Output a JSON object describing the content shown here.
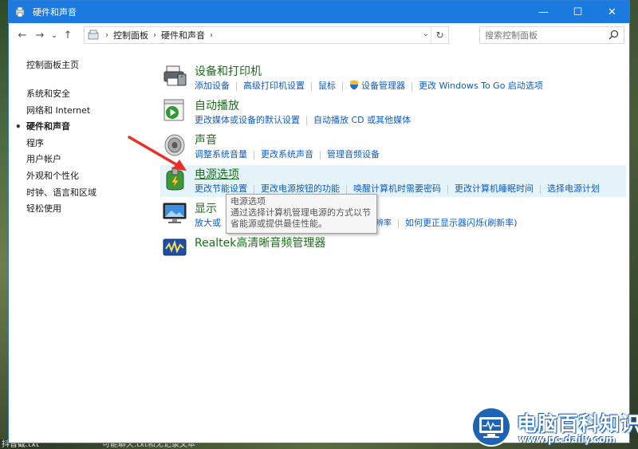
{
  "window": {
    "title": "硬件和声音",
    "controls": {
      "minimize": "—",
      "maximize": "☐",
      "close": "✕"
    }
  },
  "nav": {
    "back": "←",
    "forward": "→",
    "recent": "⌄",
    "up": "↑"
  },
  "address": {
    "crumbs": [
      "控制面板",
      "硬件和声音"
    ],
    "sep": "›",
    "dropdown": "⌄",
    "refresh": "↻"
  },
  "search": {
    "placeholder": "搜索控制面板"
  },
  "sidebar": {
    "home": "控制面板主页",
    "items": [
      {
        "label": "系统和安全"
      },
      {
        "label": "网络和 Internet"
      },
      {
        "label": "硬件和声音",
        "current": true
      },
      {
        "label": "程序"
      },
      {
        "label": "用户帐户"
      },
      {
        "label": "外观和个性化"
      },
      {
        "label": "时钟、语言和区域"
      },
      {
        "label": "轻松使用"
      }
    ],
    "bullet": "•"
  },
  "categories": [
    {
      "title": "设备和打印机",
      "icon": "printer-icon",
      "links": [
        "添加设备",
        "高级打印机设置",
        "鼠标",
        "设备管理器",
        "更改 Windows To Go 启动选项"
      ]
    },
    {
      "title": "自动播放",
      "icon": "autoplay-icon",
      "links": [
        "更改媒体或设备的默认设置",
        "自动播放 CD 或其他媒体"
      ]
    },
    {
      "title": "声音",
      "icon": "speaker-icon",
      "links": [
        "调整系统音量",
        "更改系统声音",
        "管理音频设备"
      ]
    },
    {
      "title": "电源选项",
      "icon": "power-icon",
      "links": [
        "更改节能设置",
        "更改电源按钮的功能",
        "唤醒计算机时需要密码",
        "更改计算机睡眠时间",
        "选择电源计划"
      ]
    },
    {
      "title": "显示",
      "icon": "monitor-icon",
      "links": [
        "放大或",
        "调整屏幕分辨率",
        "如何更正显示器闪烁(刷新率)"
      ]
    },
    {
      "title": "Realtek高清晰音频管理器",
      "icon": "realtek-icon",
      "links": []
    }
  ],
  "tooltip": {
    "title": "电源选项",
    "body": "通过选择计算机管理电源的方式以节省能源或提供最佳性能。"
  },
  "desktop": {
    "bottom_left": "抖音截.txt",
    "bottom_mid": "可能聊天.txt和无记录文本"
  },
  "watermark": {
    "brand": "电脑百科知识",
    "url": "www.pc-daily.com"
  },
  "colors": {
    "titlebar": "#1b7ae0",
    "category_title": "#1c6e1c",
    "link": "#0d5ccf",
    "hover_bg": "#e5f3fb",
    "annotation_arrow": "#e8302a"
  }
}
